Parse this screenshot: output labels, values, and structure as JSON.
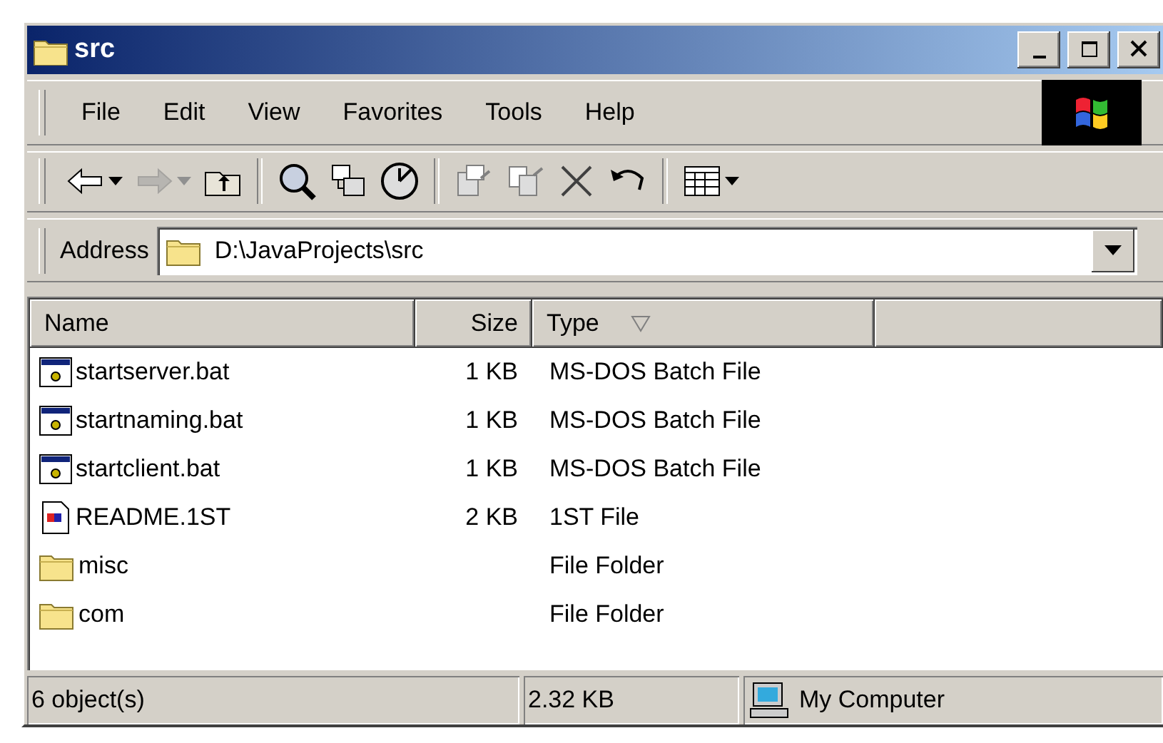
{
  "window": {
    "title": "src"
  },
  "menu": [
    {
      "label": "File"
    },
    {
      "label": "Edit"
    },
    {
      "label": "View"
    },
    {
      "label": "Favorites"
    },
    {
      "label": "Tools"
    },
    {
      "label": "Help"
    }
  ],
  "toolbar": [
    {
      "kind": "back",
      "disabled": false,
      "dropdown": true
    },
    {
      "kind": "forward",
      "disabled": true,
      "dropdown": true
    },
    {
      "kind": "up",
      "disabled": false,
      "dropdown": false
    },
    {
      "kind": "separator"
    },
    {
      "kind": "search",
      "disabled": false,
      "dropdown": false
    },
    {
      "kind": "folders",
      "disabled": false,
      "dropdown": false
    },
    {
      "kind": "history",
      "disabled": false,
      "dropdown": false
    },
    {
      "kind": "separator"
    },
    {
      "kind": "move",
      "disabled": false,
      "dropdown": false
    },
    {
      "kind": "copy",
      "disabled": false,
      "dropdown": false
    },
    {
      "kind": "delete",
      "disabled": false,
      "dropdown": false
    },
    {
      "kind": "undo",
      "disabled": false,
      "dropdown": false
    },
    {
      "kind": "separator"
    },
    {
      "kind": "views",
      "disabled": false,
      "dropdown": true
    }
  ],
  "address": {
    "label": "Address",
    "value": "D:\\JavaProjects\\src"
  },
  "columns": [
    {
      "label": "Name",
      "sorted": false
    },
    {
      "label": "Size",
      "sorted": false
    },
    {
      "label": "Type",
      "sorted": true
    }
  ],
  "rows": [
    {
      "kind": "batch",
      "name": "startserver.bat",
      "size": "1 KB",
      "type": "MS-DOS Batch File"
    },
    {
      "kind": "batch",
      "name": "startnaming.bat",
      "size": "1 KB",
      "type": "MS-DOS Batch File"
    },
    {
      "kind": "batch",
      "name": "startclient.bat",
      "size": "1 KB",
      "type": "MS-DOS Batch File"
    },
    {
      "kind": "document",
      "name": "README.1ST",
      "size": "2 KB",
      "type": "1ST File"
    },
    {
      "kind": "folder",
      "name": "misc",
      "type": "File Folder"
    },
    {
      "kind": "folder",
      "name": "com",
      "type": "File Folder"
    }
  ],
  "status_bar": {
    "objects": "6 object(s)",
    "size": "2.32 KB",
    "zone": "My Computer"
  }
}
